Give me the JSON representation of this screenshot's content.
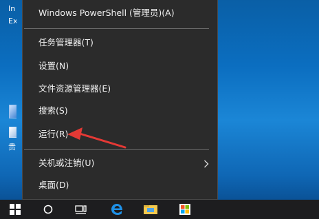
{
  "desktop": {
    "fragment_1": "In",
    "fragment_2": "Ex",
    "fragment_3": "贵"
  },
  "context_menu": {
    "items": [
      {
        "label": "Windows PowerShell (管理员)(A)"
      },
      {
        "label": "任务管理器(T)"
      },
      {
        "label": "设置(N)"
      },
      {
        "label": "文件资源管理器(E)"
      },
      {
        "label": "搜索(S)"
      },
      {
        "label": "运行(R)"
      },
      {
        "label": "关机或注销(U)",
        "submenu_icon": "chevron-right-icon"
      },
      {
        "label": "桌面(D)"
      }
    ]
  },
  "annotation": {
    "arrow_color": "#e53935",
    "points_to": "运行(R)"
  },
  "taskbar": {
    "icons": [
      "windows-start-icon",
      "cortana-search-icon",
      "task-view-icon",
      "edge-browser-icon",
      "file-explorer-icon",
      "store-icon"
    ]
  },
  "colors": {
    "menu_bg": "#2b2b2b",
    "menu_text": "#f0f0f0",
    "taskbar_bg": "#1d1d1f",
    "accent": "#1e90e6"
  }
}
